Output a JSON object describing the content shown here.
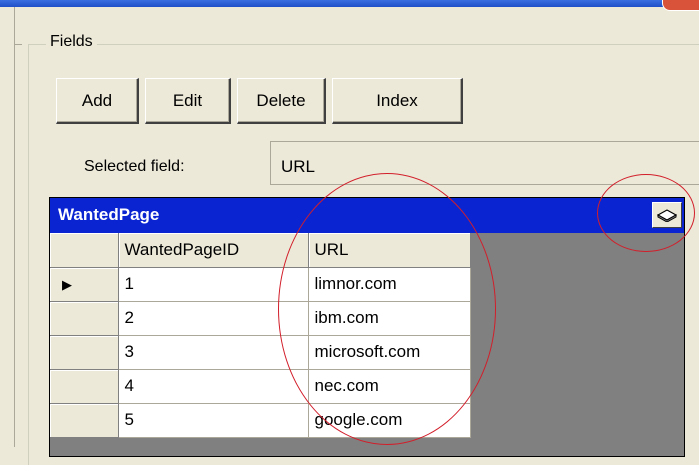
{
  "fields_group": {
    "label": "Fields"
  },
  "toolbar": {
    "add_label": "Add",
    "edit_label": "Edit",
    "delete_label": "Delete",
    "index_label": "Index"
  },
  "selected_field": {
    "label": "Selected field:",
    "value": "URL"
  },
  "grid": {
    "caption": "WantedPage",
    "collapse_icon": "collapse-caption-icon",
    "columns": [
      "WantedPageID",
      "URL"
    ],
    "current_row_icon": "row-pointer-icon",
    "rows": [
      [
        "1",
        "limnor.com"
      ],
      [
        "2",
        "ibm.com"
      ],
      [
        "3",
        "microsoft.com"
      ],
      [
        "4",
        "nec.com"
      ],
      [
        "5",
        "google.com"
      ]
    ]
  },
  "colors": {
    "caption_bg": "#0a24d2",
    "annotation": "#d21e2a",
    "panel_bg": "#ece9d8"
  }
}
